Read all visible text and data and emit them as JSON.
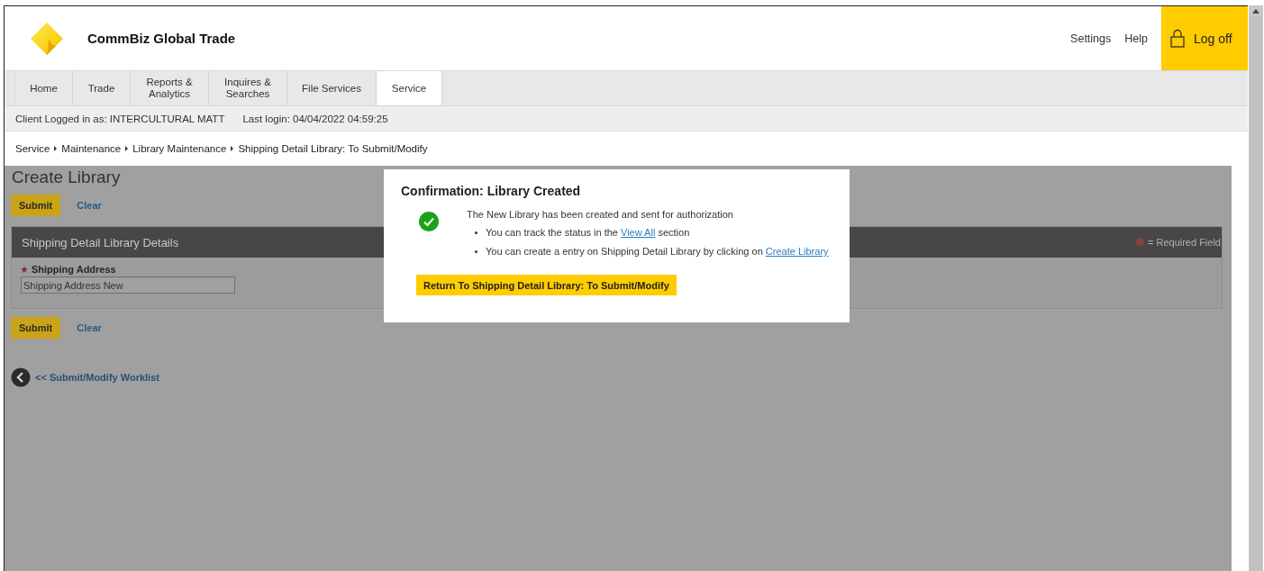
{
  "header": {
    "brand": "CommBiz Global Trade",
    "links": [
      "Settings",
      "Help"
    ],
    "logoff": "Log off"
  },
  "nav": {
    "tabs": [
      {
        "label": "Home",
        "selected": false
      },
      {
        "label": "Trade",
        "selected": false
      },
      {
        "label": "Reports &\nAnalytics",
        "selected": false
      },
      {
        "label": "Inquires &\nSearches",
        "selected": false
      },
      {
        "label": "File Services",
        "selected": false
      },
      {
        "label": "Service",
        "selected": true
      }
    ]
  },
  "info_bar": [
    "Client Logged in as: INTERCULTURAL MATT",
    "Last login: 04/04/2022 04:59:25"
  ],
  "breadcrumb": [
    "Service",
    "Maintenance",
    "Library Maintenance",
    "Shipping Detail Library: To Submit/Modify"
  ],
  "page": {
    "title": "Create Library",
    "actions": [
      "Submit",
      "Clear"
    ],
    "section": {
      "title": "Shipping Detail Library Details",
      "required_note": "= Required Field",
      "fields": [
        {
          "label": "Shipping Address",
          "required": true,
          "value": "Shipping Address New"
        }
      ]
    },
    "bottom_actions": [
      "Submit",
      "Clear"
    ],
    "back_link": "<< Submit/Modify Worklist"
  },
  "dialog": {
    "title": "Confirmation: Library Created",
    "message": "The New Library has been created and sent for authorization",
    "bullets": [
      {
        "before": "You can track the status in the ",
        "link": "View All",
        "after": " section"
      },
      {
        "before": "You can create a entry on Shipping Detail Library by clicking on ",
        "link": "Create Library"
      }
    ],
    "button": "Return To Shipping Detail Library: To Submit/Modify"
  }
}
